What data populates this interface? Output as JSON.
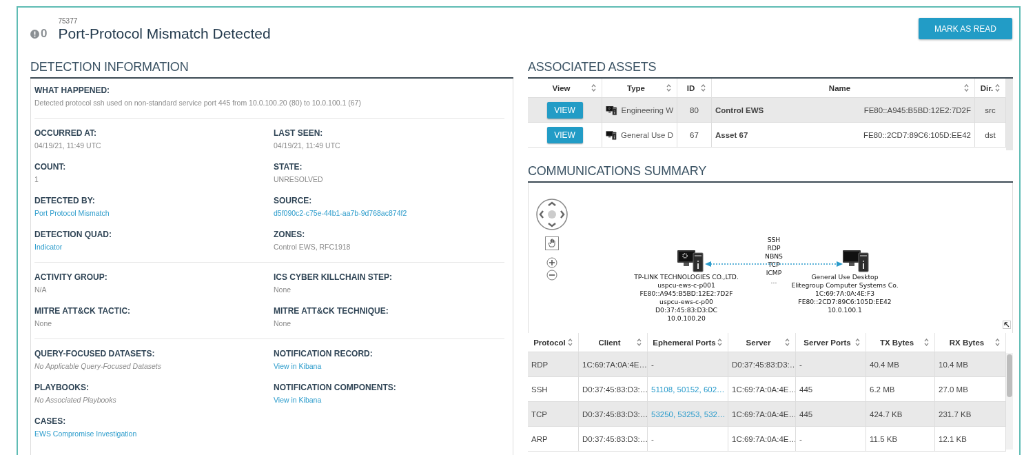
{
  "alert": {
    "count": "0",
    "id": "75377",
    "title": "Port-Protocol Mismatch Detected",
    "action": "MARK AS READ"
  },
  "detection": {
    "heading": "DETECTION INFORMATION",
    "groups": [
      {
        "kind": "single",
        "fields": [
          {
            "label": "WHAT HAPPENED:",
            "value": "Detected protocol ssh used on non-standard service port 445 from 10.0.100.20 (80) to 10.0.100.1 (67)",
            "kind": "plain"
          }
        ]
      },
      {
        "kind": "pair",
        "fields": [
          {
            "label": "OCCURRED AT:",
            "value": "04/19/21, 11:49 UTC",
            "kind": "plain"
          },
          {
            "label": "LAST SEEN:",
            "value": "04/19/21, 11:49 UTC",
            "kind": "plain"
          },
          {
            "label": "COUNT:",
            "value": "1",
            "kind": "plain"
          },
          {
            "label": "STATE:",
            "value": "UNRESOLVED",
            "kind": "plain"
          },
          {
            "label": "DETECTED BY:",
            "value": "Port Protocol Mismatch",
            "kind": "link"
          },
          {
            "label": "SOURCE:",
            "value": "d5f090c2-c75e-44b1-aa7b-9d768ac874f2",
            "kind": "link"
          },
          {
            "label": "DETECTION QUAD:",
            "value": "Indicator",
            "kind": "link"
          },
          {
            "label": "ZONES:",
            "value": "Control EWS, RFC1918",
            "kind": "plain"
          }
        ]
      },
      {
        "kind": "pair",
        "fields": [
          {
            "label": "ACTIVITY GROUP:",
            "value": "N/A",
            "kind": "plain"
          },
          {
            "label": "ICS CYBER KILLCHAIN STEP:",
            "value": "None",
            "kind": "plain"
          },
          {
            "label": "MITRE ATT&CK TACTIC:",
            "value": "None",
            "kind": "plain"
          },
          {
            "label": "MITRE ATT&CK TECHNIQUE:",
            "value": "None",
            "kind": "plain"
          }
        ]
      },
      {
        "kind": "pair",
        "fields": [
          {
            "label": "QUERY-FOCUSED DATASETS:",
            "value": "No Applicable Query-Focused Datasets",
            "kind": "note"
          },
          {
            "label": "NOTIFICATION RECORD:",
            "value": "View in Kibana",
            "kind": "link"
          },
          {
            "label": "PLAYBOOKS:",
            "value": "No Associated Playbooks",
            "kind": "note"
          },
          {
            "label": "NOTIFICATION COMPONENTS:",
            "value": "View in Kibana",
            "kind": "link"
          },
          {
            "label": "CASES:",
            "value": "EWS Compromise Investigation",
            "kind": "link"
          }
        ]
      }
    ]
  },
  "assets": {
    "heading": "ASSOCIATED ASSETS",
    "columns": [
      "View",
      "Type",
      "ID",
      "Name",
      "Dir."
    ],
    "rows": [
      {
        "button": "VIEW",
        "kind": "engineering",
        "type": "Engineering W",
        "id": "80",
        "name": "Control EWS",
        "address": "FE80::A945:B5BD:12E2:7D2F",
        "dir": "src"
      },
      {
        "button": "VIEW",
        "kind": "desktop",
        "type": "General Use D",
        "id": "67",
        "name": "Asset 67",
        "address": "FE80::2CD7:89C6:105D:EE42",
        "dir": "dst"
      }
    ]
  },
  "communications": {
    "heading": "COMMUNICATIONS SUMMARY",
    "diagram": {
      "protocols": [
        "SSH",
        "RDP",
        "NBNS",
        "TCP",
        "ICMP",
        "..."
      ],
      "nodes": [
        {
          "kind": "engineering",
          "lines": [
            "TP-LINK TECHNOLOGIES CO.,LTD.",
            "uspcu-ews-c-p001",
            "FE80::A945:B5BD:12E2:7D2F",
            "uspcu-ews-c-p00",
            "D0:37:45:83:D3:DC",
            "10.0.100.20"
          ]
        },
        {
          "kind": "desktop",
          "lines": [
            "General Use Desktop",
            "Elitegroup Computer Systems Co.",
            "1C:69:7A:0A:4E:F3",
            "FE80::2CD7:89C6:105D:EE42",
            "10.0.100.1"
          ]
        }
      ]
    },
    "columns": [
      "Protocol",
      "Client",
      "Ephemeral Ports",
      "Server",
      "Server Ports",
      "TX Bytes",
      "RX Bytes"
    ],
    "rows": [
      {
        "protocol": "RDP",
        "client": "1C:69:7A:0A:4E…",
        "ephemeral_ports": "-",
        "ports_link": false,
        "server": "D0:37:45:83:D3:…",
        "server_ports": "-",
        "tx_bytes": "40.4 MB",
        "rx_bytes": "10.4 MB"
      },
      {
        "protocol": "SSH",
        "client": "D0:37:45:83:D3:…",
        "ephemeral_ports": "51108, 50152, 602…",
        "ports_link": true,
        "server": "1C:69:7A:0A:4E…",
        "server_ports": "445",
        "tx_bytes": "6.2 MB",
        "rx_bytes": "27.0 MB"
      },
      {
        "protocol": "TCP",
        "client": "D0:37:45:83:D3:…",
        "ephemeral_ports": "53250, 53253, 532…",
        "ports_link": true,
        "server": "1C:69:7A:0A:4E…",
        "server_ports": "445",
        "tx_bytes": "424.7 KB",
        "rx_bytes": "231.7 KB"
      },
      {
        "protocol": "ARP",
        "client": "D0:37:45:83:D3:…",
        "ephemeral_ports": "-",
        "ports_link": false,
        "server": "1C:69:7A:0A:4E…",
        "server_ports": "-",
        "tx_bytes": "11.5 KB",
        "rx_bytes": "12.1 KB"
      }
    ]
  }
}
